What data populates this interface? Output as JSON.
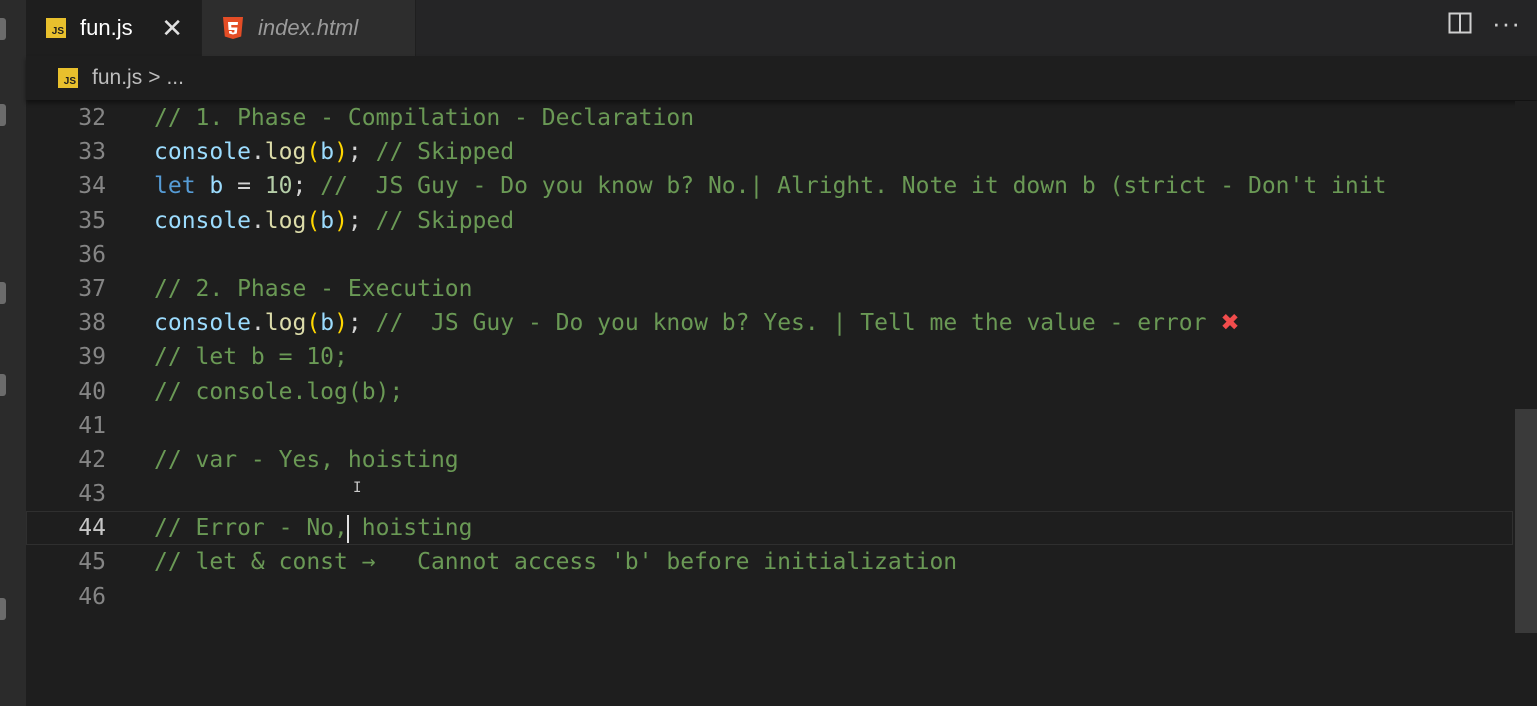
{
  "tabs": [
    {
      "label": "fun.js",
      "icon": "js-icon",
      "active": true,
      "close": "✕"
    },
    {
      "label": "index.html",
      "icon": "html5-icon",
      "active": false
    }
  ],
  "js_badge": "JS",
  "breadcrumb": {
    "file": "fun.js",
    "separator": ">",
    "more": "..."
  },
  "actions": {
    "more": "···"
  },
  "lines": [
    {
      "n": "32",
      "tokens": [
        [
          "cm",
          "// 1. Phase - Compilation - Declaration"
        ]
      ]
    },
    {
      "n": "33",
      "tokens": [
        [
          "vr",
          "console"
        ],
        [
          "pn",
          "."
        ],
        [
          "fn",
          "log"
        ],
        [
          "br",
          "("
        ],
        [
          "vr",
          "b"
        ],
        [
          "br",
          ")"
        ],
        [
          "pn",
          "; "
        ],
        [
          "cm",
          "// Skipped"
        ]
      ]
    },
    {
      "n": "34",
      "tokens": [
        [
          "kw",
          "let"
        ],
        [
          "pn",
          " "
        ],
        [
          "vr",
          "b"
        ],
        [
          "pn",
          " = "
        ],
        [
          "nm",
          "10"
        ],
        [
          "pn",
          "; "
        ],
        [
          "cm",
          "//  JS Guy - Do you know b? No.| Alright. Note it down b (strict - Don't init"
        ]
      ]
    },
    {
      "n": "35",
      "tokens": [
        [
          "vr",
          "console"
        ],
        [
          "pn",
          "."
        ],
        [
          "fn",
          "log"
        ],
        [
          "br",
          "("
        ],
        [
          "vr",
          "b"
        ],
        [
          "br",
          ")"
        ],
        [
          "pn",
          "; "
        ],
        [
          "cm",
          "// Skipped"
        ]
      ]
    },
    {
      "n": "36",
      "tokens": []
    },
    {
      "n": "37",
      "tokens": [
        [
          "cm",
          "// 2. Phase - Execution"
        ]
      ]
    },
    {
      "n": "38",
      "tokens": [
        [
          "vr",
          "console"
        ],
        [
          "pn",
          "."
        ],
        [
          "fn",
          "log"
        ],
        [
          "br",
          "("
        ],
        [
          "vr",
          "b"
        ],
        [
          "br",
          ")"
        ],
        [
          "pn",
          "; "
        ],
        [
          "cm",
          "//  JS Guy - Do you know b? Yes. | Tell me the value - error "
        ],
        [
          "cross",
          "✖"
        ]
      ]
    },
    {
      "n": "39",
      "tokens": [
        [
          "cm",
          "// let b = 10;"
        ]
      ]
    },
    {
      "n": "40",
      "tokens": [
        [
          "cm",
          "// console.log(b);"
        ]
      ]
    },
    {
      "n": "41",
      "tokens": []
    },
    {
      "n": "42",
      "tokens": [
        [
          "cm",
          "// var - Yes, hoisting"
        ]
      ]
    },
    {
      "n": "43",
      "tokens": []
    },
    {
      "n": "44",
      "current": true,
      "tokens": [
        [
          "cm",
          "// Error - No,"
        ],
        [
          "caret",
          ""
        ],
        [
          "cm",
          " hoisting"
        ]
      ]
    },
    {
      "n": "45",
      "tokens": [
        [
          "cm",
          "// let & const →   Cannot access 'b' before initialization"
        ]
      ]
    },
    {
      "n": "46",
      "tokens": []
    }
  ],
  "colors": {
    "comment": "#6a9955",
    "keyword": "#569cd6",
    "variable": "#9cdcfe",
    "function": "#dcdcaa",
    "number": "#b5cea8",
    "error": "#f14c4c"
  }
}
